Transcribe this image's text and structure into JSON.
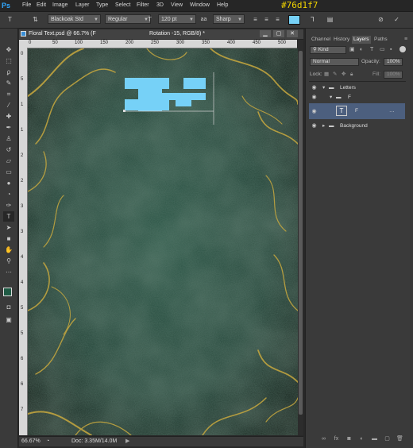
{
  "app": {
    "logo": "Ps",
    "callout": "#76d1f7"
  },
  "menu": [
    "File",
    "Edit",
    "Image",
    "Layer",
    "Type",
    "Select",
    "Filter",
    "3D",
    "View",
    "Window",
    "Help"
  ],
  "options": {
    "font_family": "Blackoak Std",
    "font_style": "Regular",
    "font_size": "120 pt",
    "aa_label": "aa",
    "antialias": "Sharp",
    "text_color": "#76d1f7"
  },
  "document": {
    "title": "Floral Text.psd @ 66.7% (F",
    "subtitle": "Rotation -15, RGB/8) *",
    "zoom": "66.67%",
    "doc_size": "Doc: 3.35M/14.0M",
    "ruler_marks": [
      "0",
      "50",
      "100",
      "150",
      "200",
      "250",
      "300",
      "350",
      "400",
      "450",
      "500"
    ],
    "ruler_marks_v": [
      "0",
      "5",
      "1",
      "1",
      "2",
      "2",
      "3",
      "3",
      "4",
      "4",
      "5",
      "5",
      "6",
      "6",
      "7"
    ]
  },
  "panels": {
    "tabs": [
      "Channel",
      "History",
      "Layers",
      "Paths"
    ],
    "kind_label": "Kind",
    "blend_mode": "Normal",
    "opacity_label": "Opacity:",
    "opacity": "100%",
    "lock_label": "Lock:",
    "fill_label": "Fill:",
    "fill": "100%",
    "layers": [
      {
        "name": "Letters",
        "type": "group",
        "expanded": true
      },
      {
        "name": "F",
        "type": "group",
        "expanded": true
      },
      {
        "name": "F",
        "type": "text",
        "selected": true
      },
      {
        "name": "Background",
        "type": "group",
        "expanded": false
      }
    ]
  }
}
